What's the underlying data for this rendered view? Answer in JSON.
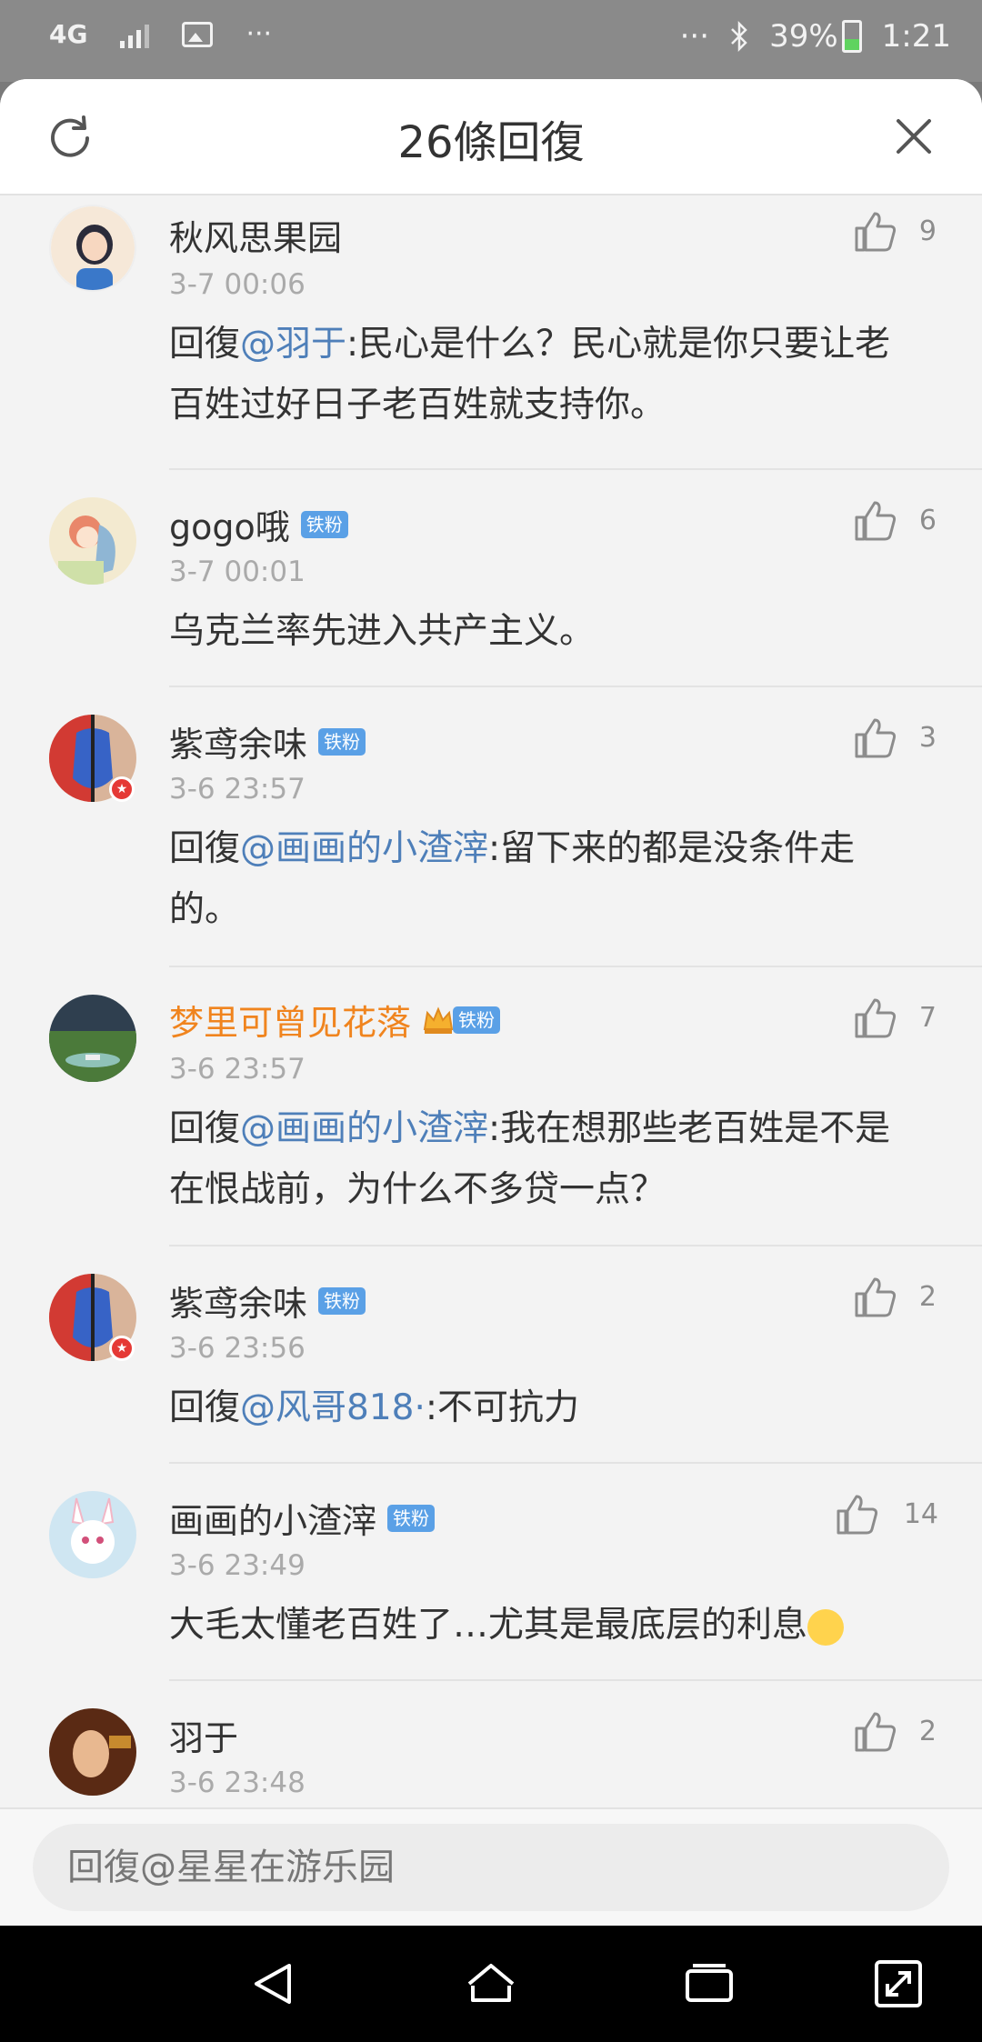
{
  "status_bar": {
    "network": "4G",
    "dots_left": "···",
    "dots_right": "···",
    "battery": "39%",
    "time": "1:21"
  },
  "header": {
    "title": "26條回復"
  },
  "comments": [
    {
      "username": "秋风思果园",
      "badge": "",
      "time": "3-7 00:06",
      "likes": "9",
      "reply_prefix": "回復",
      "mention": "@羽于",
      "text": ":民心是什么？民心就是你只要让老百姓过好日子老百姓就支持你。"
    },
    {
      "username": "gogo哦",
      "badge": "铁粉",
      "time": "3-7 00:01",
      "likes": "6",
      "reply_prefix": "",
      "mention": "",
      "text": "乌克兰率先进入共产主义。"
    },
    {
      "username": "紫鸢余味",
      "badge": "铁粉",
      "time": "3-6 23:57",
      "likes": "3",
      "reply_prefix": "回復",
      "mention": "@画画的小渣滓",
      "text": ":留下来的都是没条件走的。"
    },
    {
      "username": "梦里可曾见花落",
      "badge": "铁粉",
      "time": "3-6 23:57",
      "likes": "7",
      "reply_prefix": "回復",
      "mention": "@画画的小渣滓",
      "text": ":我在想那些老百姓是不是在恨战前，为什么不多贷一点？"
    },
    {
      "username": "紫鸢余味",
      "badge": "铁粉",
      "time": "3-6 23:56",
      "likes": "2",
      "reply_prefix": "回復",
      "mention": "@风哥818·",
      "text": ":不可抗力"
    },
    {
      "username": "画画的小渣滓",
      "badge": "铁粉",
      "time": "3-6 23:49",
      "likes": "14",
      "reply_prefix": "",
      "mention": "",
      "text": "大毛太懂老百姓了…尤其是最底层的利息"
    },
    {
      "username": "羽于",
      "badge": "",
      "time": "3-6 23:48",
      "likes": "2",
      "reply_prefix": "",
      "mention": "",
      "text": ""
    }
  ],
  "input": {
    "placeholder": "回復@星星在游乐园"
  },
  "icons": {
    "refresh": "refresh-icon",
    "close": "close-icon",
    "like": "thumbs-up-icon",
    "back": "back-icon",
    "home": "home-icon",
    "recents": "recents-icon",
    "expand": "expand-icon"
  },
  "colors": {
    "mention": "#4e7fb9",
    "vip_name": "#f0841e",
    "badge": "#5aa0e6"
  }
}
